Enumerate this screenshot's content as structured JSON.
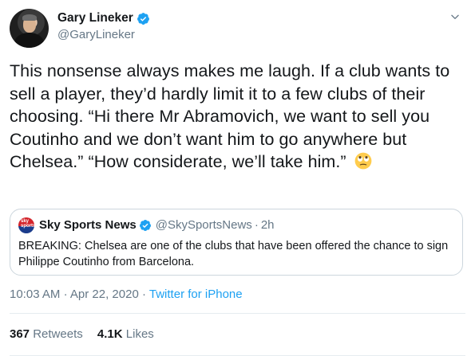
{
  "author": {
    "display_name": "Gary Lineker",
    "handle": "@GaryLineker",
    "verified": true
  },
  "tweet": {
    "text": "This nonsense always makes me laugh. If a club wants to sell a player, they’d hardly limit it to a few clubs of their choosing. “Hi there Mr Abramovich, we want to sell you Coutinho and we don’t want him to go anywhere but Chelsea.” “How considerate, we’ll take him.”",
    "emoji": "face-with-rolling-eyes"
  },
  "quoted_tweet": {
    "display_name": "Sky Sports News",
    "handle": "@SkySportsNews",
    "separator": "·",
    "time": "2h",
    "text": "BREAKING: Chelsea are one of the clubs that have been offered the chance to sign Philippe Coutinho from Barcelona.",
    "logo_text": "sky sports"
  },
  "meta": {
    "time": "10:03 AM",
    "separator": "·",
    "date": "Apr 22, 2020",
    "source": "Twitter for iPhone"
  },
  "stats": {
    "retweets_count": "367",
    "retweets_label": "Retweets",
    "likes_count": "4.1K",
    "likes_label": "Likes"
  },
  "colors": {
    "accent": "#1da1f2",
    "secondary_text": "#657786",
    "primary_text": "#14171a",
    "border": "#ccd6dd"
  },
  "icons": [
    "verified-badge-icon",
    "chevron-down-icon",
    "rolling-eyes-emoji-icon",
    "sky-sports-logo-icon"
  ]
}
